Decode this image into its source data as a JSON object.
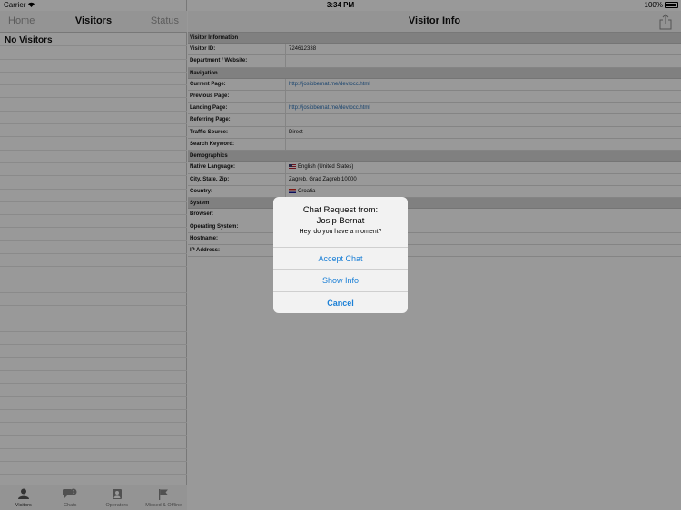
{
  "status_bar": {
    "carrier": "Carrier",
    "time": "3:34 PM",
    "battery": "100%"
  },
  "left_panel": {
    "nav": {
      "home": "Home",
      "title": "Visitors",
      "status": "Status"
    },
    "empty_text": "No Visitors",
    "tabs": [
      {
        "label": "Visitors",
        "icon": "person-icon"
      },
      {
        "label": "Chats",
        "icon": "chat-bubble-icon",
        "badge": "1"
      },
      {
        "label": "Operators",
        "icon": "operator-badge-icon"
      },
      {
        "label": "Missed & Offline",
        "icon": "flag-icon"
      }
    ]
  },
  "right_panel": {
    "title": "Visitor Info",
    "sections": [
      {
        "title": "Visitor Information",
        "rows": [
          {
            "label": "Visitor ID:",
            "value": "724612338"
          },
          {
            "label": "Department / Website:",
            "value": ""
          }
        ]
      },
      {
        "title": "Navigation",
        "rows": [
          {
            "label": "Current Page:",
            "value": "http://josipbernat.me/dev/occ.html",
            "link": true
          },
          {
            "label": "Previous Page:",
            "value": ""
          },
          {
            "label": "Landing Page:",
            "value": "http://josipbernat.me/dev/occ.html",
            "link": true
          },
          {
            "label": "Referring Page:",
            "value": ""
          },
          {
            "label": "Traffic Source:",
            "value": "Direct"
          },
          {
            "label": "Search Keyword:",
            "value": ""
          }
        ]
      },
      {
        "title": "Demographics",
        "rows": [
          {
            "label": "Native Language:",
            "value": "English (United States)",
            "flag": "us-flag-icon"
          },
          {
            "label": "City, State, Zip:",
            "value": "Zagreb, Grad Zagreb 10000"
          },
          {
            "label": "Country:",
            "value": "Croatia",
            "flag": "croatia-flag-icon"
          }
        ]
      },
      {
        "title": "System",
        "rows": [
          {
            "label": "Browser:",
            "value": ""
          },
          {
            "label": "Operating System:",
            "value": ""
          },
          {
            "label": "Hostname:",
            "value": ""
          },
          {
            "label": "IP Address:",
            "value": ""
          }
        ]
      }
    ]
  },
  "alert": {
    "title_line1": "Chat Request from:",
    "title_line2": "Josip Bernat",
    "message": "Hey, do you have a moment?",
    "buttons": {
      "accept": "Accept Chat",
      "info": "Show Info",
      "cancel": "Cancel"
    }
  },
  "colors": {
    "accent": "#1a7fd6",
    "link": "#2a72b8",
    "section_bg": "#d6d6d6"
  }
}
